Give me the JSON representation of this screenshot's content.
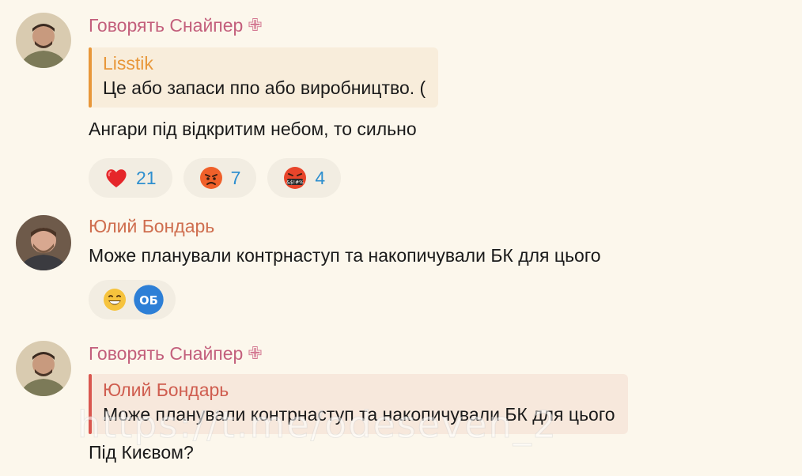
{
  "messages": [
    {
      "author": "Говорять Снайпер",
      "admin_mark": "✙",
      "quote": {
        "author": "Lisstik",
        "text": "Це або запаси ппо або виробництво. ("
      },
      "text": "Ангари під відкритим небом, то сильно",
      "reactions": [
        {
          "icon": "heart-icon",
          "count": "21"
        },
        {
          "icon": "angry-face-icon",
          "count": "7"
        },
        {
          "icon": "cursing-face-icon",
          "count": "4"
        }
      ]
    },
    {
      "author": "Юлий Бондарь",
      "text": "Може планували контрнаступ та накопичували БК для цього",
      "reactions": [
        {
          "icon": "grinning-face-icon"
        },
        {
          "icon": "ob-avatar-icon",
          "label": "ОБ"
        }
      ]
    },
    {
      "author": "Говорять Снайпер",
      "admin_mark": "✙",
      "quote": {
        "author": "Юлий Бондарь",
        "text": "Може планували контрнаступ та накопичували БК для цього"
      },
      "text": "Під Києвом?"
    }
  ],
  "watermark": "https://t.me/odeseven_2",
  "colors": {
    "background": "#fcf7ec",
    "author_pink": "#c35f7c",
    "author_orange": "#cf6e4f",
    "quote_orange": "#e8973a",
    "quote_red": "#d9574f",
    "reaction_count": "#2e8fcf"
  }
}
